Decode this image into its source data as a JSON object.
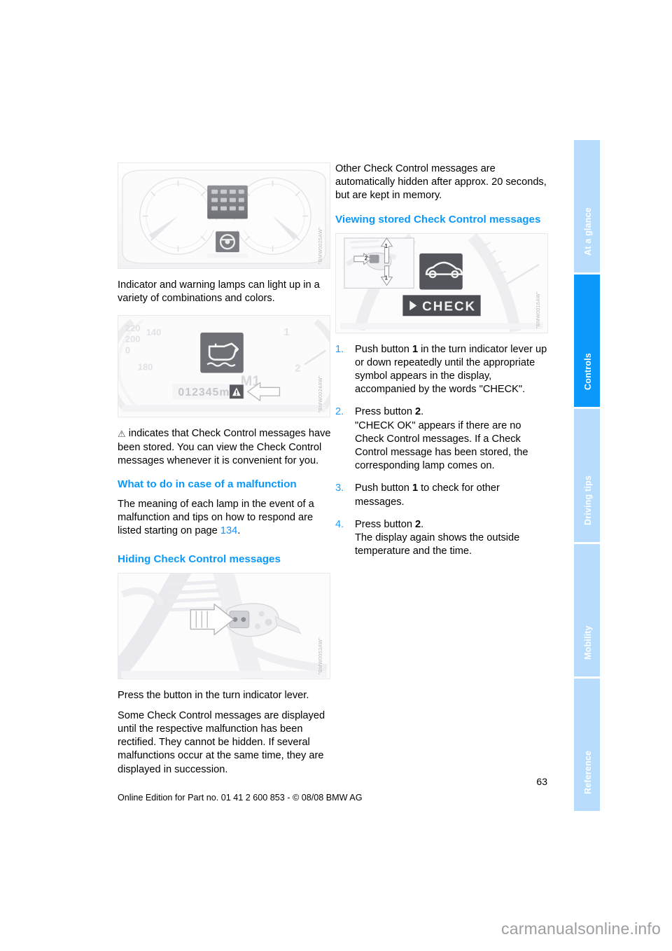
{
  "document": {
    "page_number": "63",
    "edition_line": "Online Edition for Part no. 01 41 2 600 853 - © 08/08 BMW AG",
    "watermark": "carmanualsonline.info"
  },
  "tabs": [
    {
      "label": "At a glance",
      "active": false
    },
    {
      "label": "Controls",
      "active": true
    },
    {
      "label": "Driving tips",
      "active": false
    },
    {
      "label": "Mobility",
      "active": false
    },
    {
      "label": "Reference",
      "active": false
    }
  ],
  "colors": {
    "accent_blue": "#0a99fa",
    "tab_inactive": "#b8dcfb",
    "link_blue": "#1f8ff5"
  },
  "left_column": {
    "figure_cluster": {
      "name": "instrument-cluster-with-indicator-lamps",
      "code": "\"BMW0025AW\"",
      "display_symbols": [
        "lamp-row-1",
        "lamp-row-2",
        "lamp-row-3"
      ],
      "lower_symbol": "steering-wheel-warning-symbol"
    },
    "paragraph_1": "Indicator and warning lamps can light up in a variety of combinations and colors.",
    "figure_oil": {
      "name": "instrument-cluster-oil-level-warning",
      "code": "\"BMW0024AW\"",
      "speedo_ticks": [
        "220",
        "200",
        "0",
        "180"
      ],
      "rpm_ticks": [
        "1",
        "2"
      ],
      "odometer": "012345mls",
      "gear_display": "M1",
      "symbol": "oil-can-warning-symbol",
      "callout": "warning-triangle-with-arrow"
    },
    "paragraph_2_prefix_icon": "⚠",
    "paragraph_2": "indicates that Check Control messages have been stored. You can view the Check Control messages whenever it is convenient for you.",
    "heading_malfunction": "What to do in case of a malfunction",
    "paragraph_3_part_1": "The meaning of each lamp in the event of a malfunction and tips on how to respond are listed starting on page ",
    "paragraph_3_page_ref": "134",
    "paragraph_3_part_2": ".",
    "heading_hiding": "Hiding Check Control messages",
    "figure_lever": {
      "name": "turn-indicator-lever-button",
      "code": "\"BMW0053AW\"",
      "callout": "arrow-pointing-to-button"
    },
    "paragraph_4": "Press the button in the turn indicator lever.",
    "paragraph_5": "Some Check Control messages are displayed until the respective malfunction has been rectified. They cannot be hidden. If several malfunctions occur at the same time, they are displayed in succession."
  },
  "right_column": {
    "paragraph_1": "Other Check Control messages are automatically hidden after approx. 20 seconds, but are kept in memory.",
    "heading_viewing": "Viewing stored Check Control messages",
    "figure_check": {
      "name": "instrument-cluster-check-display",
      "code": "\"BMW0016AW\"",
      "inset_labels": [
        "1",
        "2",
        "1"
      ],
      "display_symbol": "car-silhouette-symbol",
      "display_text": "CHECK"
    },
    "steps": [
      {
        "num": "1.",
        "segments": [
          {
            "text": "Push button ",
            "bold": false
          },
          {
            "text": "1",
            "bold": true
          },
          {
            "text": " in the turn indicator lever up or down repeatedly until the appropriate symbol appears in the display, accompanied by the words \"CHECK\".",
            "bold": false
          }
        ]
      },
      {
        "num": "2.",
        "segments": [
          {
            "text": "Press button ",
            "bold": false
          },
          {
            "text": "2",
            "bold": true
          },
          {
            "text": ".\n\"CHECK OK\" appears if there are no Check Control messages. If a Check Control message has been stored, the corresponding lamp comes on.",
            "bold": false
          }
        ]
      },
      {
        "num": "3.",
        "segments": [
          {
            "text": "Push button ",
            "bold": false
          },
          {
            "text": "1",
            "bold": true
          },
          {
            "text": " to check for other messages.",
            "bold": false
          }
        ]
      },
      {
        "num": "4.",
        "segments": [
          {
            "text": "Press button ",
            "bold": false
          },
          {
            "text": "2",
            "bold": true
          },
          {
            "text": ".\nThe display again shows the outside temperature and the time.",
            "bold": false
          }
        ]
      }
    ],
    "step_1_text": "Push button 1 in the turn indicator lever up or down repeatedly until the appropriate symbol appears in the display, accompanied by the words \"CHECK\".",
    "step_2_text": "Press button 2.\n\"CHECK OK\" appears if there are no Check Control messages. If a Check Control message has been stored, the corresponding lamp comes on.",
    "step_3_text": "Push button 1 to check for other messages.",
    "step_4_text": "Press button 2.\nThe display again shows the outside temperature and the time."
  }
}
